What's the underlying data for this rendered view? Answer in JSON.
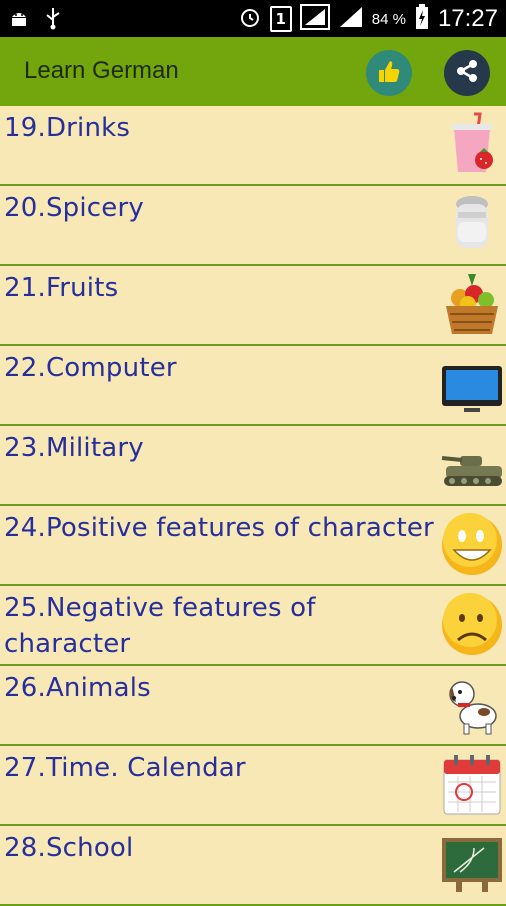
{
  "status_bar": {
    "time": "17:27",
    "battery_percent": "84 %",
    "sim_badge": "1",
    "icons": [
      "android-icon",
      "usb-icon",
      "alarm-icon",
      "sim-1-icon",
      "signal-icon",
      "signal-icon-2",
      "battery-charging-icon"
    ]
  },
  "app_bar": {
    "title": "Learn German",
    "like_icon": "thumbs-up-icon",
    "share_icon": "share-icon",
    "color": "#73a50c"
  },
  "topics": [
    {
      "label": "19.Drinks",
      "icon": "drink-icon"
    },
    {
      "label": "20.Spicery",
      "icon": "salt-shaker-icon"
    },
    {
      "label": "21.Fruits",
      "icon": "fruit-basket-icon"
    },
    {
      "label": "22.Computer",
      "icon": "monitor-icon"
    },
    {
      "label": "23.Military",
      "icon": "tank-icon"
    },
    {
      "label": "24.Positive features of character",
      "icon": "smile-icon"
    },
    {
      "label": "25.Negative features of character",
      "icon": "sad-face-icon"
    },
    {
      "label": "26.Animals",
      "icon": "dog-icon"
    },
    {
      "label": "27.Time. Calendar",
      "icon": "calendar-icon"
    },
    {
      "label": "28.School",
      "icon": "chalkboard-icon"
    }
  ],
  "colors": {
    "background": "#f7e8b6",
    "text": "#262f9c",
    "divider": "#6e9c1b"
  }
}
